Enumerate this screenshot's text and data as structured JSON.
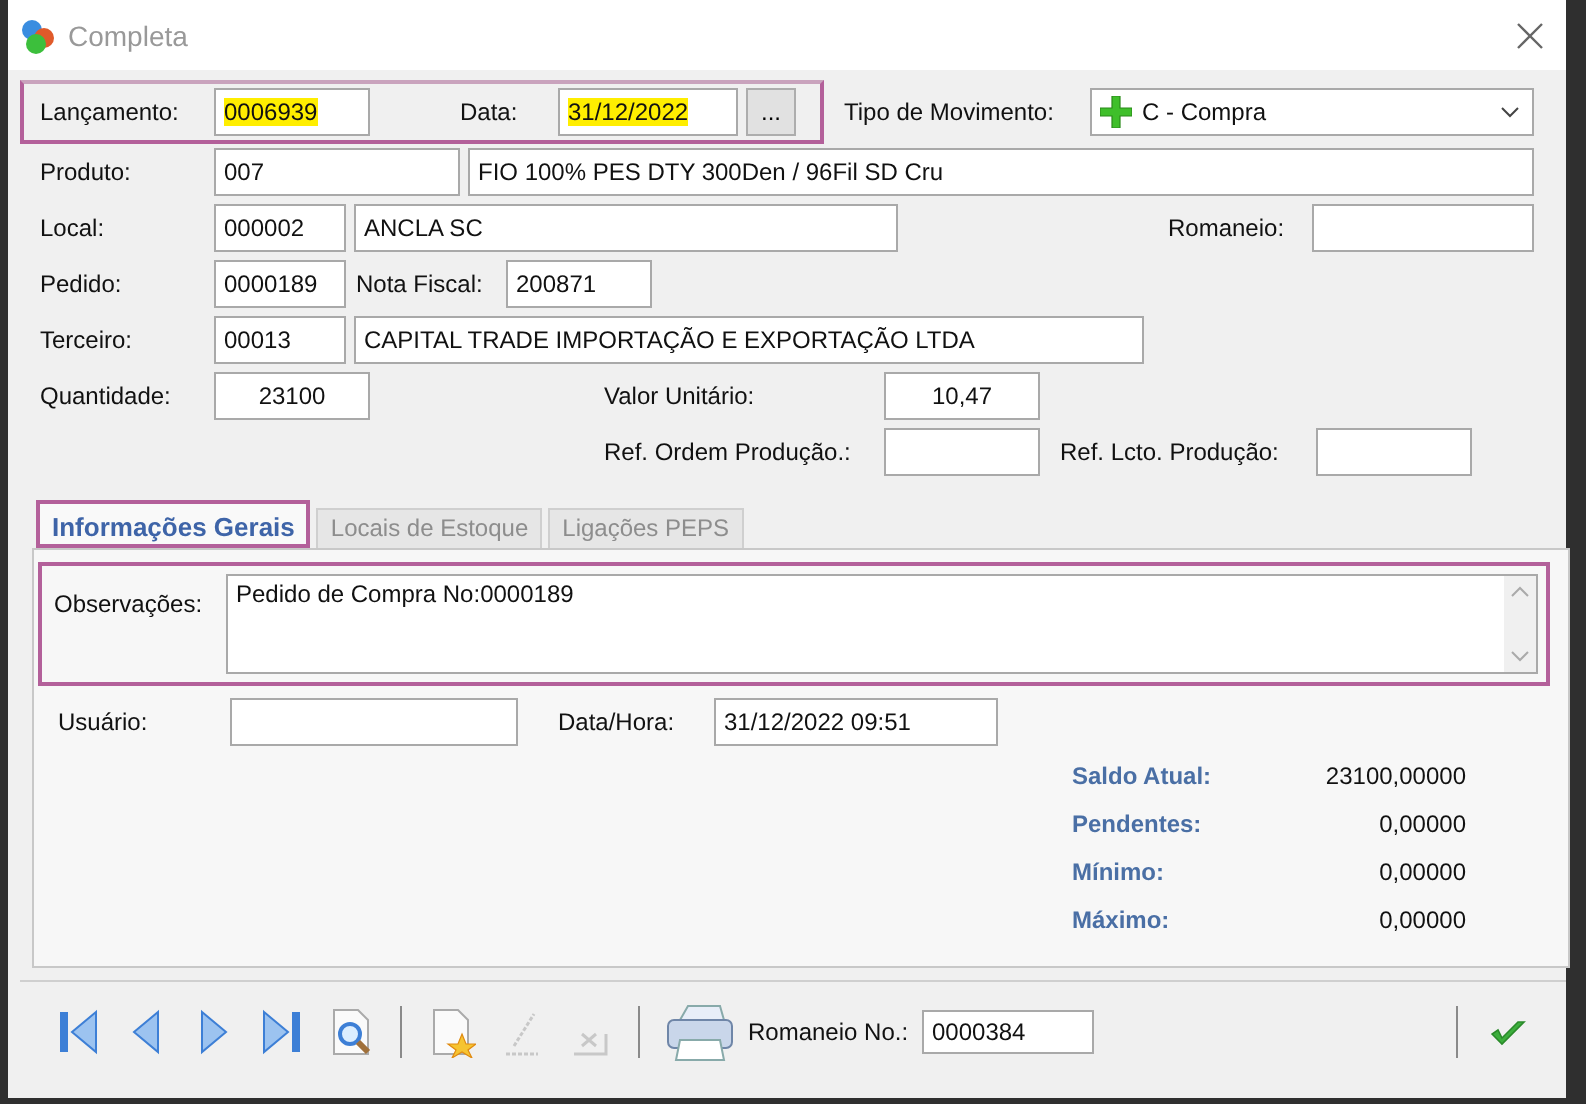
{
  "window": {
    "title": "Completa"
  },
  "header": {
    "marked": true,
    "fields": [
      {
        "label": "Lançamento:",
        "value": "0006939",
        "highlighted": true
      },
      {
        "label": "Data:",
        "value": "31/12/2022",
        "highlighted": true
      }
    ],
    "date_button": "..."
  },
  "tipo_movimento": {
    "label": "Tipo de Movimento:",
    "value": "C - Compra"
  },
  "produto": {
    "label": "Produto:",
    "code": "007",
    "description": "FIO 100% PES DTY 300Den / 96Fil SD Cru"
  },
  "local": {
    "label": "Local:",
    "code": "000002",
    "description": "ANCLA SC"
  },
  "romaneio": {
    "label": "Romaneio:"
  },
  "pedido": {
    "label": "Pedido:",
    "value": "0000189"
  },
  "nota_fiscal": {
    "label": "Nota Fiscal:",
    "value": "200871"
  },
  "terceiro": {
    "label": "Terceiro:",
    "code": "00013",
    "description": "CAPITAL TRADE IMPORTAÇÃO E EXPORTAÇÃO LTDA"
  },
  "quantidade": {
    "label": "Quantidade:",
    "value": "23100"
  },
  "valor_unitario": {
    "label": "Valor Unitário:",
    "value": "10,47"
  },
  "ref_ordem_producao": {
    "label": "Ref. Ordem Produção.:"
  },
  "ref_lcto_producao": {
    "label": "Ref. Lcto. Produção:"
  },
  "tabs": [
    {
      "label": "Informações Gerais",
      "selected": true,
      "marked": true
    },
    {
      "label": "Locais de Estoque",
      "selected": false,
      "marked": false
    },
    {
      "label": "Ligações PEPS",
      "selected": false,
      "marked": false
    }
  ],
  "observacoes": {
    "label": "Observações:",
    "value": "Pedido de Compra No:0000189",
    "marked": true
  },
  "usuario": {
    "label": "Usuário:"
  },
  "data_hora": {
    "label": "Data/Hora:",
    "value": "31/12/2022 09:51"
  },
  "summary": [
    {
      "label": "Saldo Atual:",
      "value": "23100,00000"
    },
    {
      "label": "Pendentes:",
      "value": "0,00000"
    },
    {
      "label": "Mínimo:",
      "value": "0,00000"
    },
    {
      "label": "Máximo:",
      "value": "0,00000"
    }
  ],
  "toolbar": {
    "nav_buttons": [
      {
        "kind": "first",
        "disabled": false
      },
      {
        "kind": "prev",
        "disabled": false
      },
      {
        "kind": "next",
        "disabled": false
      },
      {
        "kind": "last",
        "disabled": false
      },
      {
        "kind": "preview",
        "disabled": false
      }
    ],
    "edit_buttons": [
      {
        "kind": "new",
        "disabled": false
      },
      {
        "kind": "edit",
        "disabled": true
      },
      {
        "kind": "delete",
        "disabled": true
      }
    ],
    "romaneio_no": {
      "label": "Romaneio No.:",
      "value": "0000384"
    }
  }
}
